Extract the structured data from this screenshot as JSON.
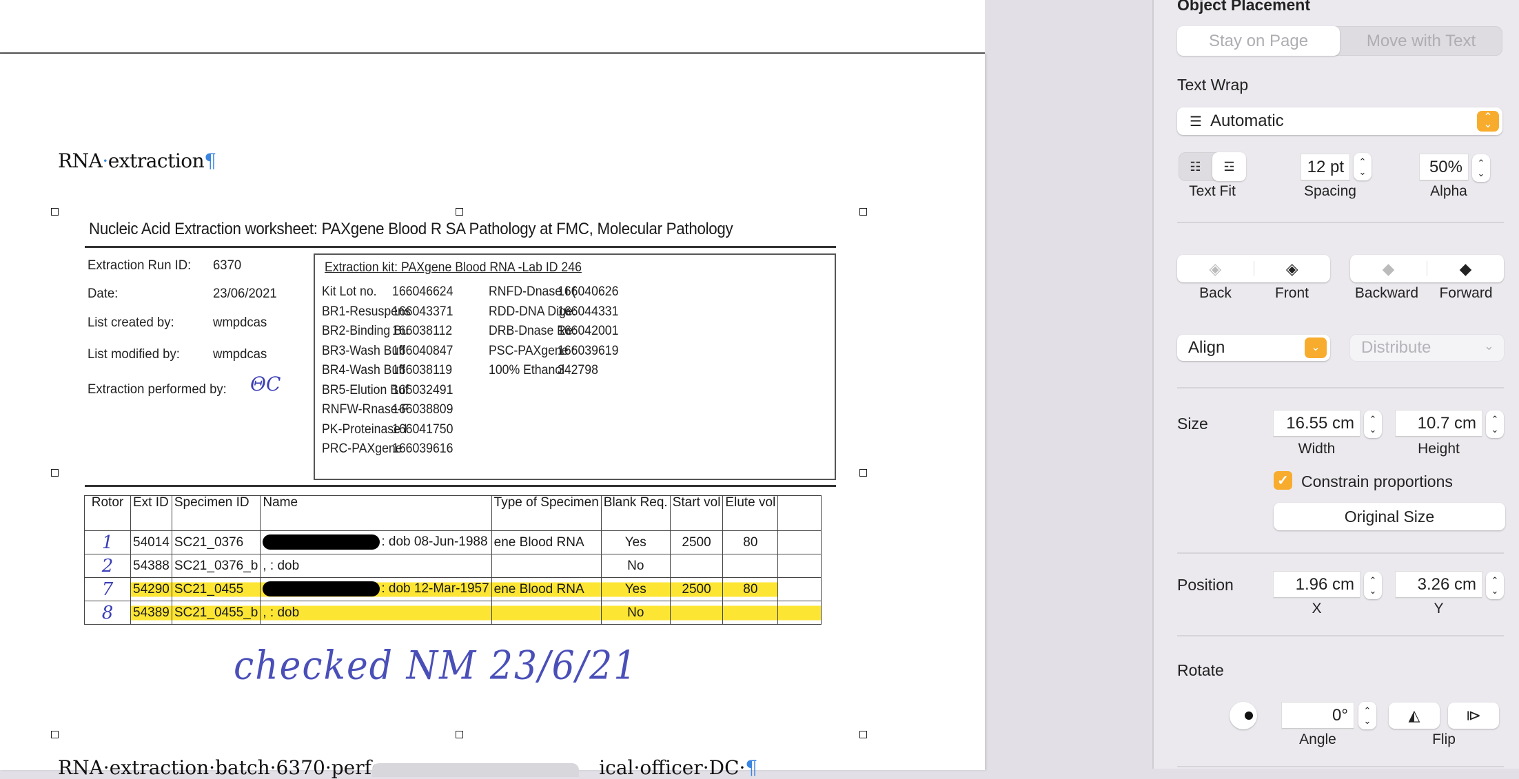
{
  "document": {
    "heading": "RNA",
    "heading_rest": "extraction",
    "heading_pilcrow": "¶",
    "footer_part1": "RNA·extraction·batch·6370·perfor",
    "footer_part2": "ical·officer·DC·",
    "footer_pilcrow": "¶"
  },
  "worksheet": {
    "title": "Nucleic Acid Extraction worksheet: PAXgene Blood R SA Pathology at FMC, Molecular Pathology",
    "meta": [
      {
        "label": "Extraction Run ID:",
        "value": "6370"
      },
      {
        "label": "Date:",
        "value": "23/06/2021"
      },
      {
        "label": "List created by:",
        "value": "wmpdcas"
      },
      {
        "label": "List modified by:",
        "value": "wmpdcas"
      },
      {
        "label": "Extraction performed by:",
        "value": "ΘC"
      }
    ],
    "kit_title": "Extraction kit: PAXgene Blood RNA -Lab ID 246",
    "kit_left": [
      {
        "name": "Kit Lot no.",
        "lot": "166046624"
      },
      {
        "name": "BR1-Resuspens",
        "lot": "166043371"
      },
      {
        "name": "BR2-Binding Bu",
        "lot": "166038112"
      },
      {
        "name": "BR3-Wash Buff",
        "lot": "166040847"
      },
      {
        "name": "BR4-Wash Buff",
        "lot": "166038119"
      },
      {
        "name": "BR5-Elution Buf",
        "lot": "166032491"
      },
      {
        "name": "RNFW-Rnase-F",
        "lot": "166038809"
      },
      {
        "name": "PK-Proteinase I",
        "lot": "166041750"
      },
      {
        "name": "PRC-PAXgene",
        "lot": "166039616"
      }
    ],
    "kit_right": [
      {
        "name": "RNFD-Dnase I (",
        "lot": "166040626"
      },
      {
        "name": "RDD-DNA Dige:",
        "lot": "166044331"
      },
      {
        "name": "DRB-Dnase Re:",
        "lot": "166042001"
      },
      {
        "name": "PSC-PAXgene :",
        "lot": "166039619"
      },
      {
        "name": "100% Ethanol",
        "lot": "342798"
      }
    ],
    "table_headers": [
      "Rotor",
      "Ext ID",
      "Specimen ID",
      "Name",
      "Type of Specimen",
      "Blank Req.",
      "Start vol",
      "Elute vol",
      ""
    ],
    "rows": [
      {
        "rotor": "1",
        "ext_id": "54014",
        "specimen_id": "SC21_0376",
        "name": ": dob 08-Jun-1988",
        "redacted": true,
        "type": "ene Blood RNA",
        "blank": "Yes",
        "start": "2500",
        "elute": "80",
        "highlight": false
      },
      {
        "rotor": "2",
        "ext_id": "54388",
        "specimen_id": "SC21_0376_b",
        "name": ",  : dob",
        "redacted": false,
        "type": "",
        "blank": "No",
        "start": "",
        "elute": "",
        "highlight": false
      },
      {
        "rotor": "7",
        "ext_id": "54290",
        "specimen_id": "SC21_0455",
        "name": ": dob 12-Mar-1957",
        "redacted": true,
        "type": "ene Blood RNA",
        "blank": "Yes",
        "start": "2500",
        "elute": "80",
        "highlight": true
      },
      {
        "rotor": "8",
        "ext_id": "54389",
        "specimen_id": "SC21_0455_b",
        "name": ",  : dob",
        "redacted": false,
        "type": "",
        "blank": "No",
        "start": "",
        "elute": "",
        "highlight": true
      }
    ],
    "checked_note": "checked NM 23/6/21"
  },
  "inspector": {
    "object_placement": {
      "title": "Object Placement",
      "options": [
        "Stay on Page",
        "Move with Text"
      ],
      "selected": "Stay on Page"
    },
    "text_wrap": {
      "title": "Text Wrap",
      "value": "Automatic",
      "text_fit_label": "Text Fit",
      "spacing_value": "12 pt",
      "spacing_label": "Spacing",
      "alpha_value": "50%",
      "alpha_label": "Alpha"
    },
    "arrange": {
      "back": "Back",
      "front": "Front",
      "backward": "Backward",
      "forward": "Forward",
      "align": "Align",
      "distribute": "Distribute"
    },
    "size": {
      "title": "Size",
      "width_value": "16.55 cm",
      "width_label": "Width",
      "height_value": "10.7 cm",
      "height_label": "Height",
      "constrain_label": "Constrain proportions",
      "constrain_checked": true,
      "original_size": "Original Size"
    },
    "position": {
      "title": "Position",
      "x_value": "1.96 cm",
      "x_label": "X",
      "y_value": "3.26 cm",
      "y_label": "Y"
    },
    "rotate": {
      "title": "Rotate",
      "angle_value": "0°",
      "angle_label": "Angle",
      "flip_label": "Flip"
    },
    "accent_color": "#f8ac2e"
  }
}
